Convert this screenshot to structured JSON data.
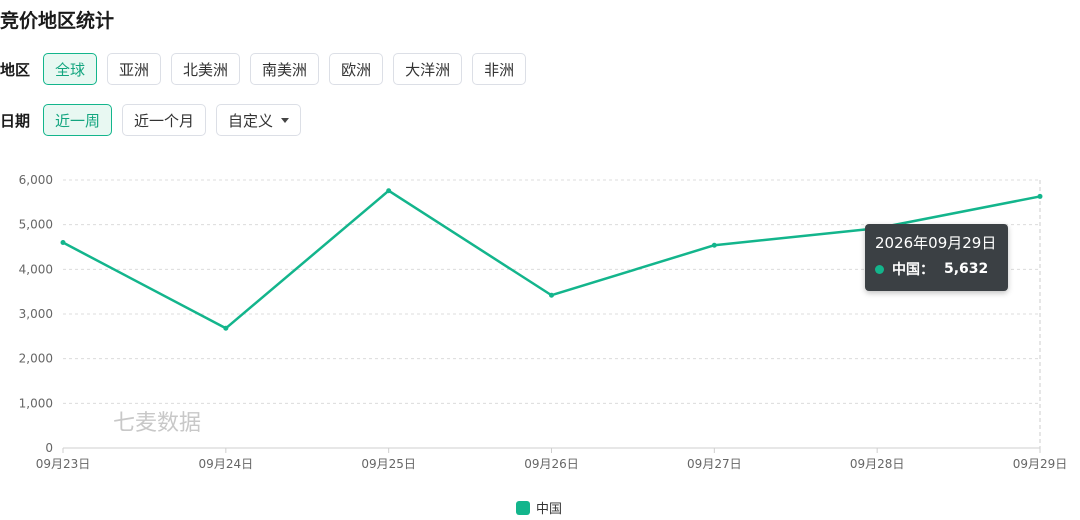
{
  "page": {
    "title": "竞价地区统计"
  },
  "filters": {
    "region": {
      "label": "地区",
      "options": [
        "全球",
        "亚洲",
        "北美洲",
        "南美洲",
        "欧洲",
        "大洋洲",
        "非洲"
      ],
      "selected": "全球"
    },
    "date": {
      "label": "日期",
      "options": [
        "近一周",
        "近一个月",
        "自定义"
      ],
      "selected": "近一周"
    }
  },
  "watermark": "七麦数据",
  "colors": {
    "series": "#13b58c",
    "accent": "#13a57f"
  },
  "tooltip": {
    "date": "2026年09月29日",
    "series": "中国：",
    "value": "5,632"
  },
  "chart_data": {
    "type": "line",
    "categories": [
      "09月23日",
      "09月24日",
      "09月25日",
      "09月26日",
      "09月27日",
      "09月28日",
      "09月29日"
    ],
    "series": [
      {
        "name": "中国",
        "values": [
          4600,
          2680,
          5760,
          3420,
          4540,
          4920,
          5632
        ]
      }
    ],
    "y_ticks": [
      "0",
      "1,000",
      "2,000",
      "3,000",
      "4,000",
      "5,000",
      "6,000"
    ],
    "ylim": [
      0,
      6000
    ],
    "grid": true,
    "legend": "bottom-center"
  }
}
